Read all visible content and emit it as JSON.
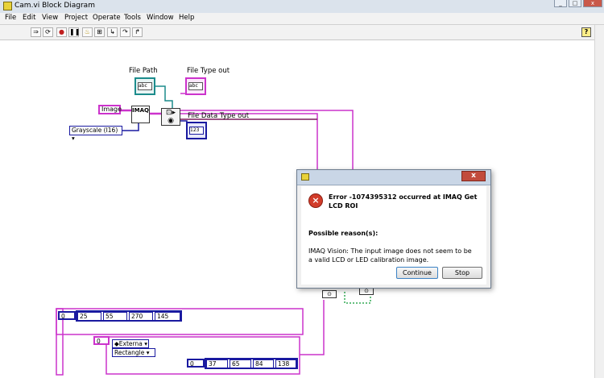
{
  "window": {
    "title": "Cam.vi Block Diagram"
  },
  "menubar": {
    "items": [
      "File",
      "Edit",
      "View",
      "Project",
      "Operate",
      "Tools",
      "Window",
      "Help"
    ]
  },
  "toolbar": {
    "help_label": "?"
  },
  "diagram": {
    "file_path_label": "File Path",
    "file_type_out_label": "File Type out",
    "file_data_type_out_label": "File Data Type out",
    "image_constant": "Image",
    "imaq_label": "IMAQ",
    "grayscale_enum": "Grayscale (I16)",
    "abc": "abc",
    "n123": "123",
    "array1": {
      "index": "0",
      "values": [
        "25",
        "55",
        "270",
        "145"
      ]
    },
    "array2": {
      "index": "0"
    },
    "enum_external": "Externa",
    "enum_rectangle": "Rectangle",
    "array3": {
      "index": "0",
      "values": [
        "37",
        "65",
        "84",
        "138"
      ]
    }
  },
  "dialog": {
    "title": "Error -1074395312 occurred at IMAQ Get LCD ROI",
    "reason_label": "Possible reason(s):",
    "reason_text": "IMAQ Vision:  The input image does not seem to be a valid LCD or LED calibration image.",
    "continue_label": "Continue",
    "stop_label": "Stop",
    "error_icon": "error-x-icon",
    "error_color": "#d23c2a"
  },
  "colors": {
    "wire_pink": "#cc33cc",
    "wire_teal": "#1c8c8c",
    "wire_blue": "#1a1aa0",
    "wire_purple": "#7a1a5a"
  }
}
